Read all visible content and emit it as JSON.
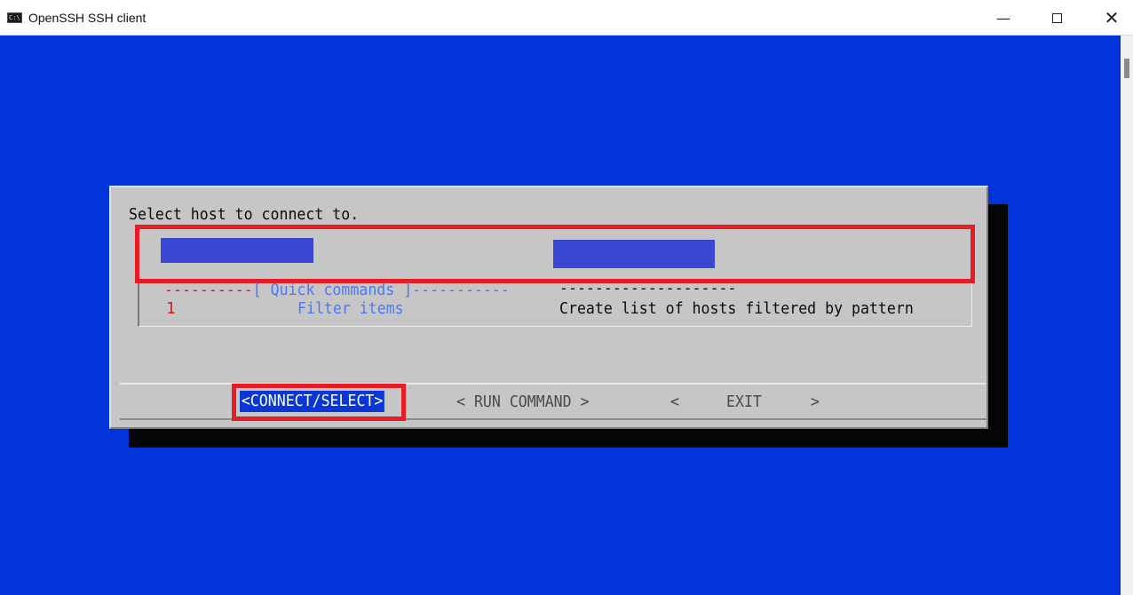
{
  "window": {
    "title": "OpenSSH SSH client",
    "minimize_glyph": "—",
    "close_glyph": "✕"
  },
  "dialog": {
    "prompt": "Select host to connect to.",
    "quick_commands": {
      "header_left_dashes": "----------",
      "header_label": "[ Quick commands ]",
      "header_right_dashes": "-----------",
      "column_dashes": "--------------------"
    },
    "items": [
      {
        "key": "1",
        "name": "Filter items",
        "description": "Create list of hosts filtered by pattern"
      }
    ],
    "buttons": {
      "connect": "<CONNECT/SELECT>",
      "run_command": "< RUN COMMAND >",
      "exit_left": "<",
      "exit": "EXIT",
      "exit_right": ">"
    }
  },
  "colors": {
    "terminal_bg": "#0033d9",
    "dialog_bg": "#c6c6c6",
    "highlight_box": "#e81c24",
    "accent_text": "#4a7bf5",
    "key_text": "#d42020",
    "selected_button_bg": "#0a36d6"
  },
  "icons": {
    "app": "terminal-icon",
    "minimize": "minimize-icon",
    "maximize": "maximize-icon",
    "close": "close-icon"
  }
}
